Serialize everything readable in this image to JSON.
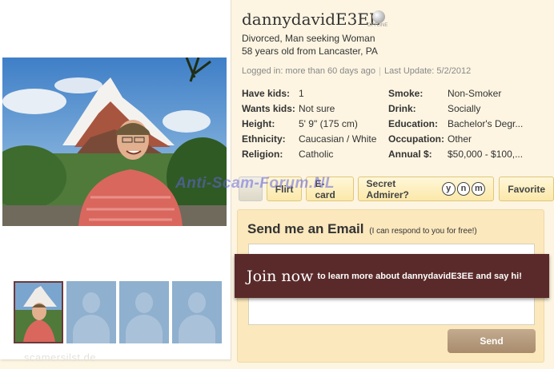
{
  "profile": {
    "username": "dannydavidE3EE",
    "status_label": "OFFLINE",
    "headline_line1": "Divorced, Man seeking Woman",
    "headline_line2": "58 years old from Lancaster, PA",
    "logged_in": "Logged in: more than 60 days ago",
    "last_update": "Last Update: 5/2/2012"
  },
  "details_left": [
    {
      "key": "Have kids:",
      "value": "1"
    },
    {
      "key": "Wants kids:",
      "value": "Not sure"
    },
    {
      "key": "Height:",
      "value": "5' 9\" (175 cm)"
    },
    {
      "key": "Ethnicity:",
      "value": "Caucasian / White"
    },
    {
      "key": "Religion:",
      "value": "Catholic"
    }
  ],
  "details_right": [
    {
      "key": "Smoke:",
      "value": "Non-Smoker"
    },
    {
      "key": "Drink:",
      "value": "Socially"
    },
    {
      "key": "Education:",
      "value": "Bachelor's Degr..."
    },
    {
      "key": "Occupation:",
      "value": "Other"
    },
    {
      "key": "Annual $:",
      "value": "$50,000 - $100,..."
    }
  ],
  "actions": {
    "flirt": "Flirt",
    "ecard": "E-card",
    "secret_admirer": "Secret Admirer?",
    "yes": "y",
    "no": "n",
    "maybe": "m",
    "favorite": "Favorite"
  },
  "email": {
    "title": "Send me an Email",
    "subtitle": "(I can respond to you for free!)",
    "send": "Send"
  },
  "join_banner": {
    "big": "Join now",
    "small": "to learn more about dannydavidE3EE and say hi!"
  },
  "watermarks": {
    "center": "Anti-Scam-Forum.NL",
    "bottom": "scamersilst.de"
  },
  "colors": {
    "banner": "#5a2a2a",
    "button_gold": "#fbe8a9",
    "email_box": "#fbe8bd",
    "send_button": "#a88b6c"
  }
}
